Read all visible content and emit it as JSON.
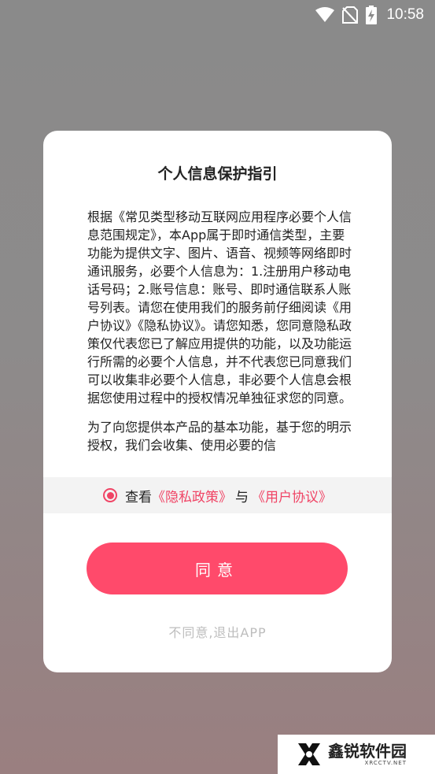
{
  "status_bar": {
    "time": "10:58",
    "icons": [
      "wifi-icon",
      "no-sim-icon",
      "battery-charging-icon"
    ]
  },
  "dialog": {
    "title": "个人信息保护指引",
    "paragraphs": [
      "根据《常见类型移动互联网应用程序必要个人信息范围规定》，本App属于即时通信类型，主要功能为提供文字、图片、语音、视频等网络即时通讯服务，必要个人信息为：1.注册用户移动电话号码；2.账号信息：账号、即时通信联系人账号列表。请您在使用我们的服务前仔细阅读《用户协议》《隐私协议》。请您知悉，您同意隐私政策仅代表您已了解应用提供的功能，以及功能运行所需的必要个人信息，并不代表您已同意我们可以收集非必要个人信息，非必要个人信息会根据您使用过程中的授权情况单独征求您的同意。",
      "为了向您提供本产品的基本功能，基于您的明示授权，我们会收集、使用必要的信"
    ],
    "consent": {
      "prefix": "查看",
      "privacy_link": "《隐私政策》",
      "conjunction": "与",
      "agreement_link": "《用户协议》",
      "checked": true
    },
    "agree_label": "同意",
    "disagree_label": "不同意,退出APP"
  },
  "watermark": {
    "name": "鑫锐软件园",
    "sub": "XRCCTV.NET"
  },
  "colors": {
    "accent": "#ff4a6b",
    "link": "#f04465"
  }
}
